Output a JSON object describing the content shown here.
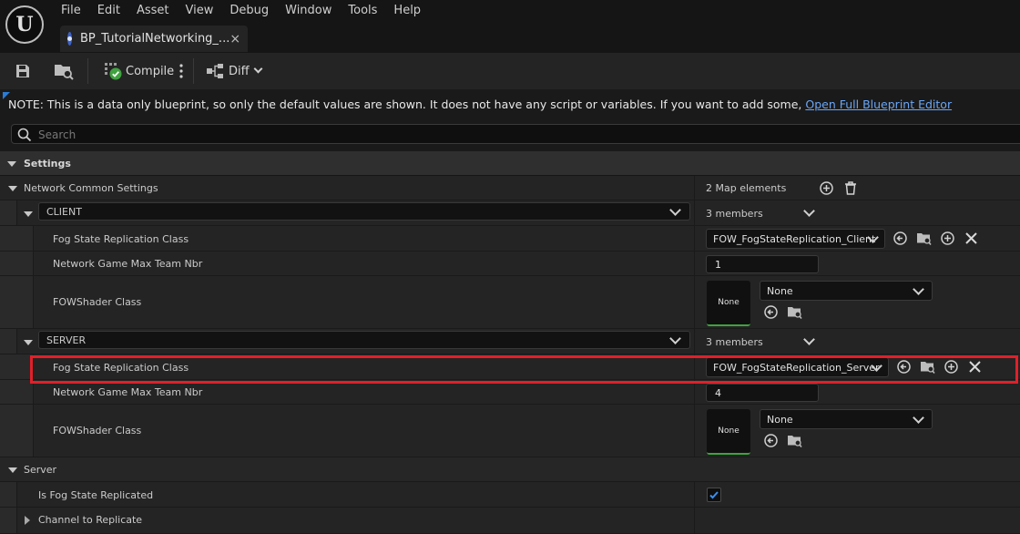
{
  "menu": [
    "File",
    "Edit",
    "Asset",
    "View",
    "Debug",
    "Window",
    "Tools",
    "Help"
  ],
  "tab": {
    "title": "BP_TutorialNetworking_...",
    "close": "×"
  },
  "toolbar": {
    "compile_label": "Compile",
    "diff_label": "Diff"
  },
  "note": {
    "text": "NOTE: This is a data only blueprint, so only the default values are shown.  It does not have any script or variables.  If you want to add some, ",
    "link": "Open Full Blueprint Editor"
  },
  "search": {
    "placeholder": "Search"
  },
  "details": {
    "settings_label": "Settings",
    "network_common_label": "Network Common Settings",
    "map_elements": "2 Map elements",
    "client": {
      "key": "CLIENT",
      "members": "3 members",
      "fog_label": "Fog State Replication Class",
      "fog_value": "FOW_FogStateReplication_Client",
      "max_team_label": "Network Game Max Team Nbr",
      "max_team_value": "1",
      "shader_label": "FOWShader Class",
      "shader_thumb": "None",
      "shader_value": "None"
    },
    "server": {
      "key": "SERVER",
      "members": "3 members",
      "fog_label": "Fog State Replication Class",
      "fog_value": "FOW_FogStateReplication_Server",
      "max_team_label": "Network Game Max Team Nbr",
      "max_team_value": "4",
      "shader_label": "FOWShader Class",
      "shader_thumb": "None",
      "shader_value": "None"
    },
    "server_category_label": "Server",
    "is_fog_replicated_label": "Is Fog State Replicated",
    "is_fog_replicated_checked": true,
    "channel_label": "Channel to Replicate"
  },
  "colors": {
    "accent_blue": "#2b7bd8",
    "link": "#6ba6f5",
    "highlight": "#e0202a",
    "compile_ok": "#3fa33f"
  }
}
